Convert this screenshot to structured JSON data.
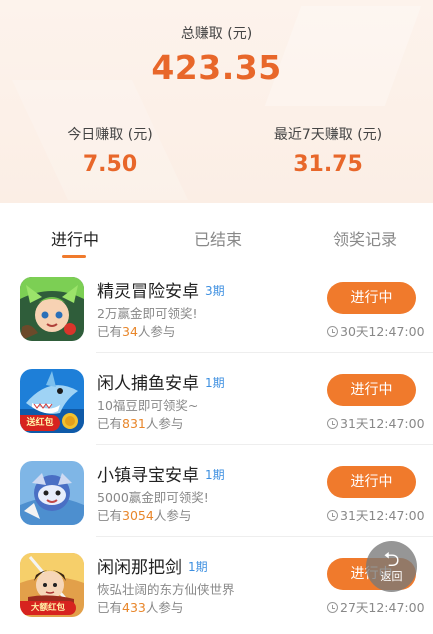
{
  "summary": {
    "total_label": "总赚取 (元)",
    "total_value": "423.35",
    "today_label": "今日赚取 (元)",
    "today_value": "7.50",
    "week_label": "最近7天赚取 (元)",
    "week_value": "31.75"
  },
  "tabs": [
    {
      "label": "进行中",
      "active": true
    },
    {
      "label": "已结束",
      "active": false
    },
    {
      "label": "领奖记录",
      "active": false
    }
  ],
  "items": [
    {
      "title": "精灵冒险安卓",
      "period": "3期",
      "desc": "2万赢金即可领奖!",
      "part_prefix": "已有",
      "part_count": "34",
      "part_suffix": "人参与",
      "button": "进行中",
      "timer": "30天12:47:00",
      "icon": "elf-game-icon"
    },
    {
      "title": "闲人捕鱼安卓",
      "period": "1期",
      "desc": "10福豆即可领奖~",
      "part_prefix": "已有",
      "part_count": "831",
      "part_suffix": "人参与",
      "button": "进行中",
      "timer": "31天12:47:00",
      "icon": "shark-game-icon",
      "badge": "送红包"
    },
    {
      "title": "小镇寻宝安卓",
      "period": "1期",
      "desc": "5000赢金即可领奖!",
      "part_prefix": "已有",
      "part_count": "3054",
      "part_suffix": "人参与",
      "button": "进行中",
      "timer": "31天12:47:00",
      "icon": "treasure-game-icon"
    },
    {
      "title": "闲闲那把剑",
      "period": "1期",
      "desc": "恢弘壮阔的东方仙侠世界",
      "part_prefix": "已有",
      "part_count": "433",
      "part_suffix": "人参与",
      "button": "进行中",
      "timer": "27天12:47:00",
      "icon": "sword-game-icon",
      "badge": "大额红包"
    }
  ],
  "floating": {
    "label": "返回",
    "icon": "back-arrow-icon"
  },
  "colors": {
    "accent": "#f07a2c",
    "value": "#e8672a",
    "period": "#3d8fe0",
    "count": "#e8862a"
  }
}
